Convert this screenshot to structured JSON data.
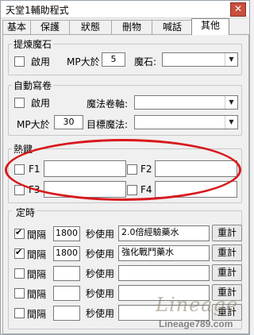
{
  "window": {
    "title": "天堂1輔助程式",
    "close_glyph": "✕"
  },
  "tabs": [
    {
      "label": "基本"
    },
    {
      "label": "保護"
    },
    {
      "label": "狀態"
    },
    {
      "label": "刪物"
    },
    {
      "label": "喊話"
    },
    {
      "label": "其他"
    }
  ],
  "stone_group": {
    "legend": "提煉魔石",
    "enable_label": "啟用",
    "enable_checked": false,
    "mp_label": "MP大於",
    "mp_value": "5",
    "stone_label": "魔石:",
    "stone_value": ""
  },
  "scroll_group": {
    "legend": "自動寫卷",
    "enable_label": "啟用",
    "enable_checked": false,
    "scroll_label": "魔法卷軸:",
    "scroll_value": "",
    "mp_label": "MP大於",
    "mp_value": "30",
    "target_label": "目標魔法:",
    "target_value": ""
  },
  "hotkey_group": {
    "legend": "熱鍵",
    "keys": [
      {
        "label": "F1",
        "checked": false,
        "value": ""
      },
      {
        "label": "F2",
        "checked": false,
        "value": ""
      },
      {
        "label": "F3",
        "checked": false,
        "value": ""
      },
      {
        "label": "F4",
        "checked": false,
        "value": ""
      }
    ]
  },
  "timer_group": {
    "legend": "定時",
    "interval_label": "間隔",
    "use_label": "秒使用",
    "reset_label": "重計",
    "rows": [
      {
        "checked": true,
        "interval": "1800",
        "item": "2.0倍經驗藥水"
      },
      {
        "checked": true,
        "interval": "1800",
        "item": "強化戰鬥藥水"
      },
      {
        "checked": false,
        "interval": "",
        "item": ""
      },
      {
        "checked": false,
        "interval": "",
        "item": ""
      },
      {
        "checked": false,
        "interval": "",
        "item": ""
      }
    ]
  },
  "watermark": {
    "logo": "Lineage",
    "url": "Lineage789.com"
  },
  "colors": {
    "highlight_ellipse": "#d8191d",
    "close_button": "#c94f3f"
  }
}
